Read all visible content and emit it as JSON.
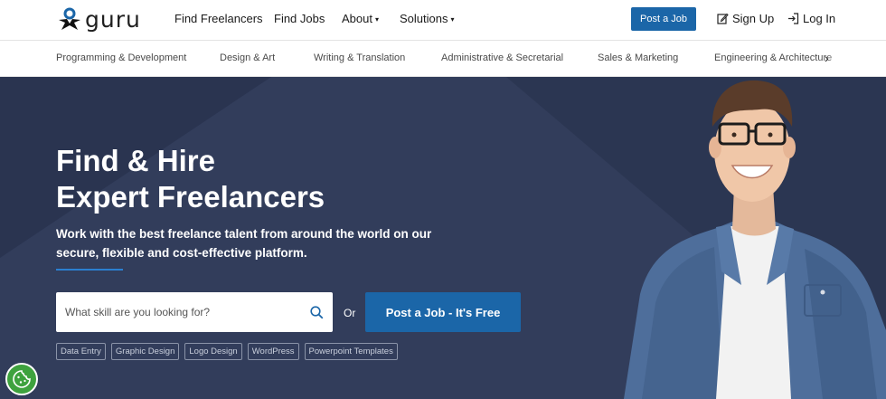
{
  "brand": {
    "name": "guru"
  },
  "nav": {
    "find_freelancers": "Find Freelancers",
    "find_jobs": "Find Jobs",
    "about": "About",
    "solutions": "Solutions",
    "post_job": "Post a Job",
    "sign_up": "Sign Up",
    "log_in": "Log In"
  },
  "categories": [
    "Programming & Development",
    "Design & Art",
    "Writing & Translation",
    "Administrative & Secretarial",
    "Sales & Marketing",
    "Engineering & Architecture"
  ],
  "hero": {
    "title_line1": "Find & Hire",
    "title_line2": "Expert Freelancers",
    "subtitle": "Work with the best freelance talent from around the world on our secure, flexible and cost-effective platform.",
    "search_placeholder": "What skill are you looking for?",
    "or_label": "Or",
    "cta": "Post a Job - It's Free",
    "tags": [
      "Data Entry",
      "Graphic Design",
      "Logo Design",
      "WordPress",
      "Powerpoint Templates"
    ]
  },
  "colors": {
    "primary": "#1b66a8",
    "hero_bg": "#2b3652",
    "cookie": "#3ea23e"
  }
}
